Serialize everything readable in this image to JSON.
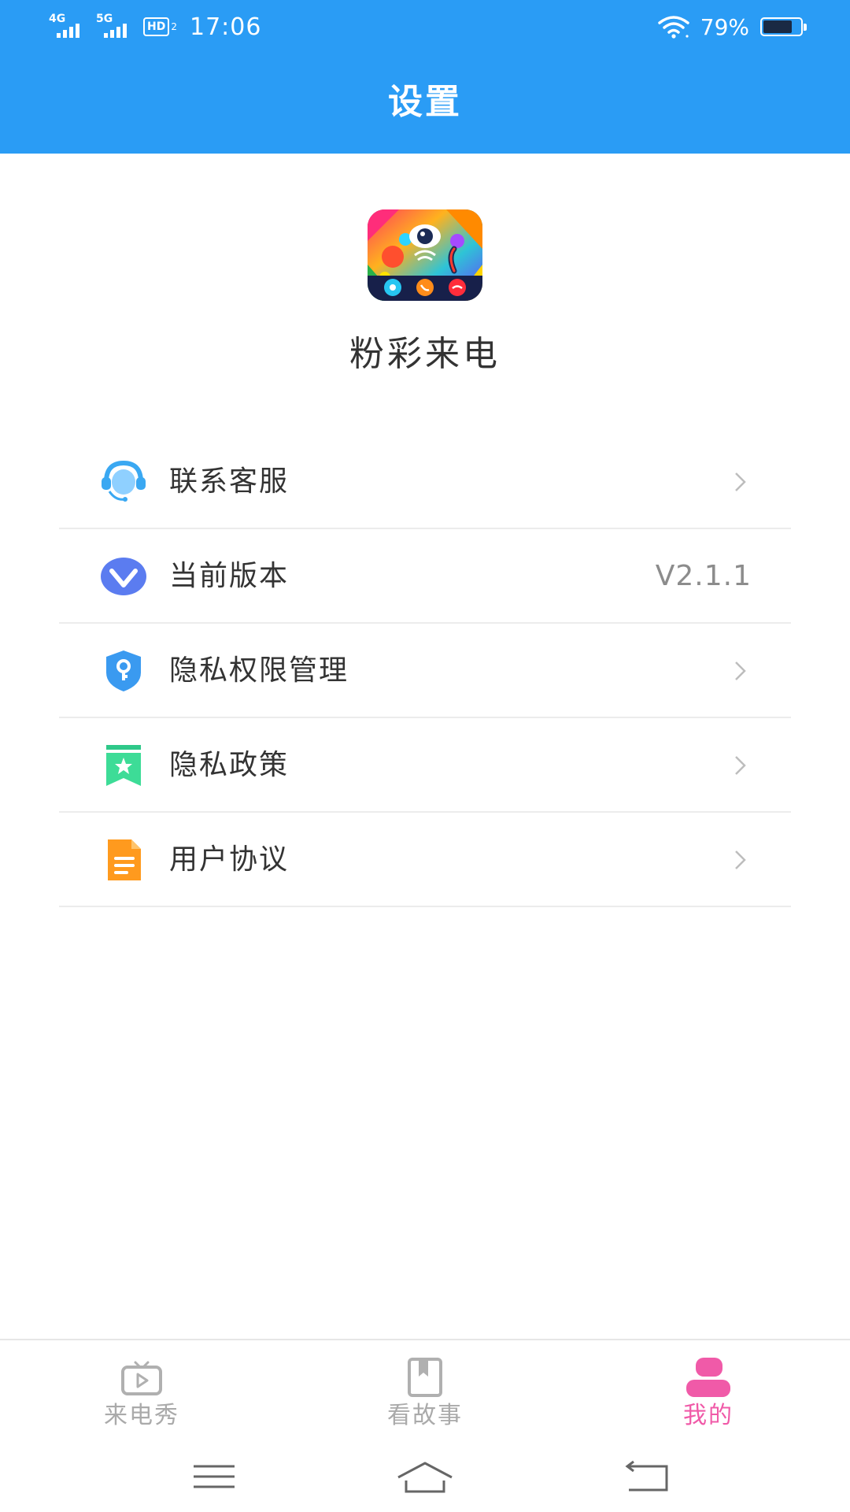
{
  "status_bar": {
    "network_1": "4G",
    "network_2": "5G",
    "hd_label": "HD",
    "hd_sub": "2",
    "time": "17:06",
    "battery_percent": "79%",
    "battery_level": 0.79,
    "icons": [
      "signal-4g-icon",
      "signal-5g-icon",
      "hd-volte-icon",
      "wifi-icon",
      "battery-icon"
    ]
  },
  "header": {
    "title": "设置",
    "color": "#2a9cf5"
  },
  "app": {
    "name": "粉彩来电",
    "logo_icon": "app-logo-icon"
  },
  "menu": {
    "items": [
      {
        "label": "联系客服",
        "icon": "customer-service-icon",
        "trailing": "chevron-right-icon"
      },
      {
        "label": "当前版本",
        "icon": "version-icon",
        "value": "V2.1.1"
      },
      {
        "label": "隐私权限管理",
        "icon": "shield-key-icon",
        "trailing": "chevron-right-icon"
      },
      {
        "label": "隐私政策",
        "icon": "privacy-bookmark-icon",
        "trailing": "chevron-right-icon"
      },
      {
        "label": "用户协议",
        "icon": "document-icon",
        "trailing": "chevron-right-icon"
      }
    ]
  },
  "tabbar": {
    "tabs": [
      {
        "label": "来电秀",
        "icon": "tv-play-icon",
        "active": false
      },
      {
        "label": "看故事",
        "icon": "book-icon",
        "active": false
      },
      {
        "label": "我的",
        "icon": "profile-icon",
        "active": true
      }
    ],
    "active_color": "#f05aa8",
    "inactive_color": "#aaaaaa"
  },
  "navbar": {
    "buttons": [
      "menu-icon",
      "home-icon",
      "back-icon"
    ]
  }
}
